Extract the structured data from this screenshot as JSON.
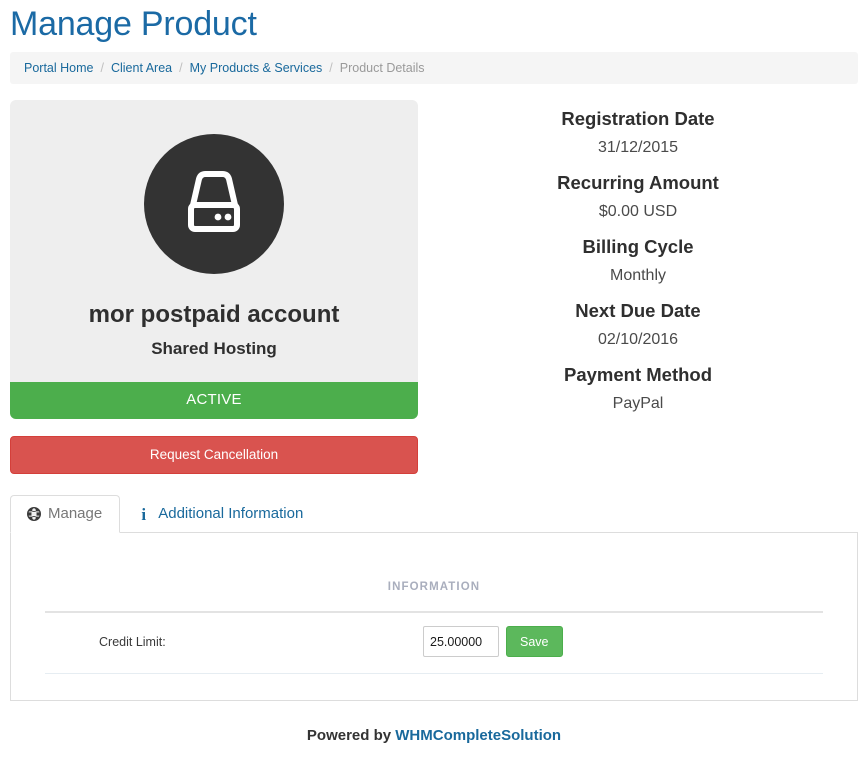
{
  "header": {
    "title": "Manage Product"
  },
  "breadcrumb": {
    "separator": "/",
    "items": [
      {
        "label": "Portal Home",
        "active": false
      },
      {
        "label": "Client Area",
        "active": false
      },
      {
        "label": "My Products & Services",
        "active": false
      },
      {
        "label": "Product Details",
        "active": true
      }
    ]
  },
  "product_card": {
    "icon": "hard-drive-icon",
    "name": "mor postpaid account",
    "group": "Shared Hosting",
    "status": "ACTIVE",
    "status_color": "#4cae4c",
    "cancel_button": "Request Cancellation",
    "cancel_color": "#d9534f"
  },
  "details": [
    {
      "label": "Registration Date",
      "value": "31/12/2015"
    },
    {
      "label": "Recurring Amount",
      "value": "$0.00 USD"
    },
    {
      "label": "Billing Cycle",
      "value": "Monthly"
    },
    {
      "label": "Next Due Date",
      "value": "02/10/2016"
    },
    {
      "label": "Payment Method",
      "value": "PayPal"
    }
  ],
  "tabs": [
    {
      "label": "Manage",
      "icon": "globe-icon",
      "active": true
    },
    {
      "label": "Additional Information",
      "icon": "info-icon",
      "active": false
    }
  ],
  "form": {
    "legend": "INFORMATION",
    "fields": [
      {
        "label": "Credit Limit:",
        "value": "25.00000",
        "placeholder": "",
        "save_label": "Save",
        "save_color": "#5cb85c"
      }
    ]
  },
  "footer": {
    "prefix": "Powered by ",
    "link": "WHMCompleteSolution"
  }
}
